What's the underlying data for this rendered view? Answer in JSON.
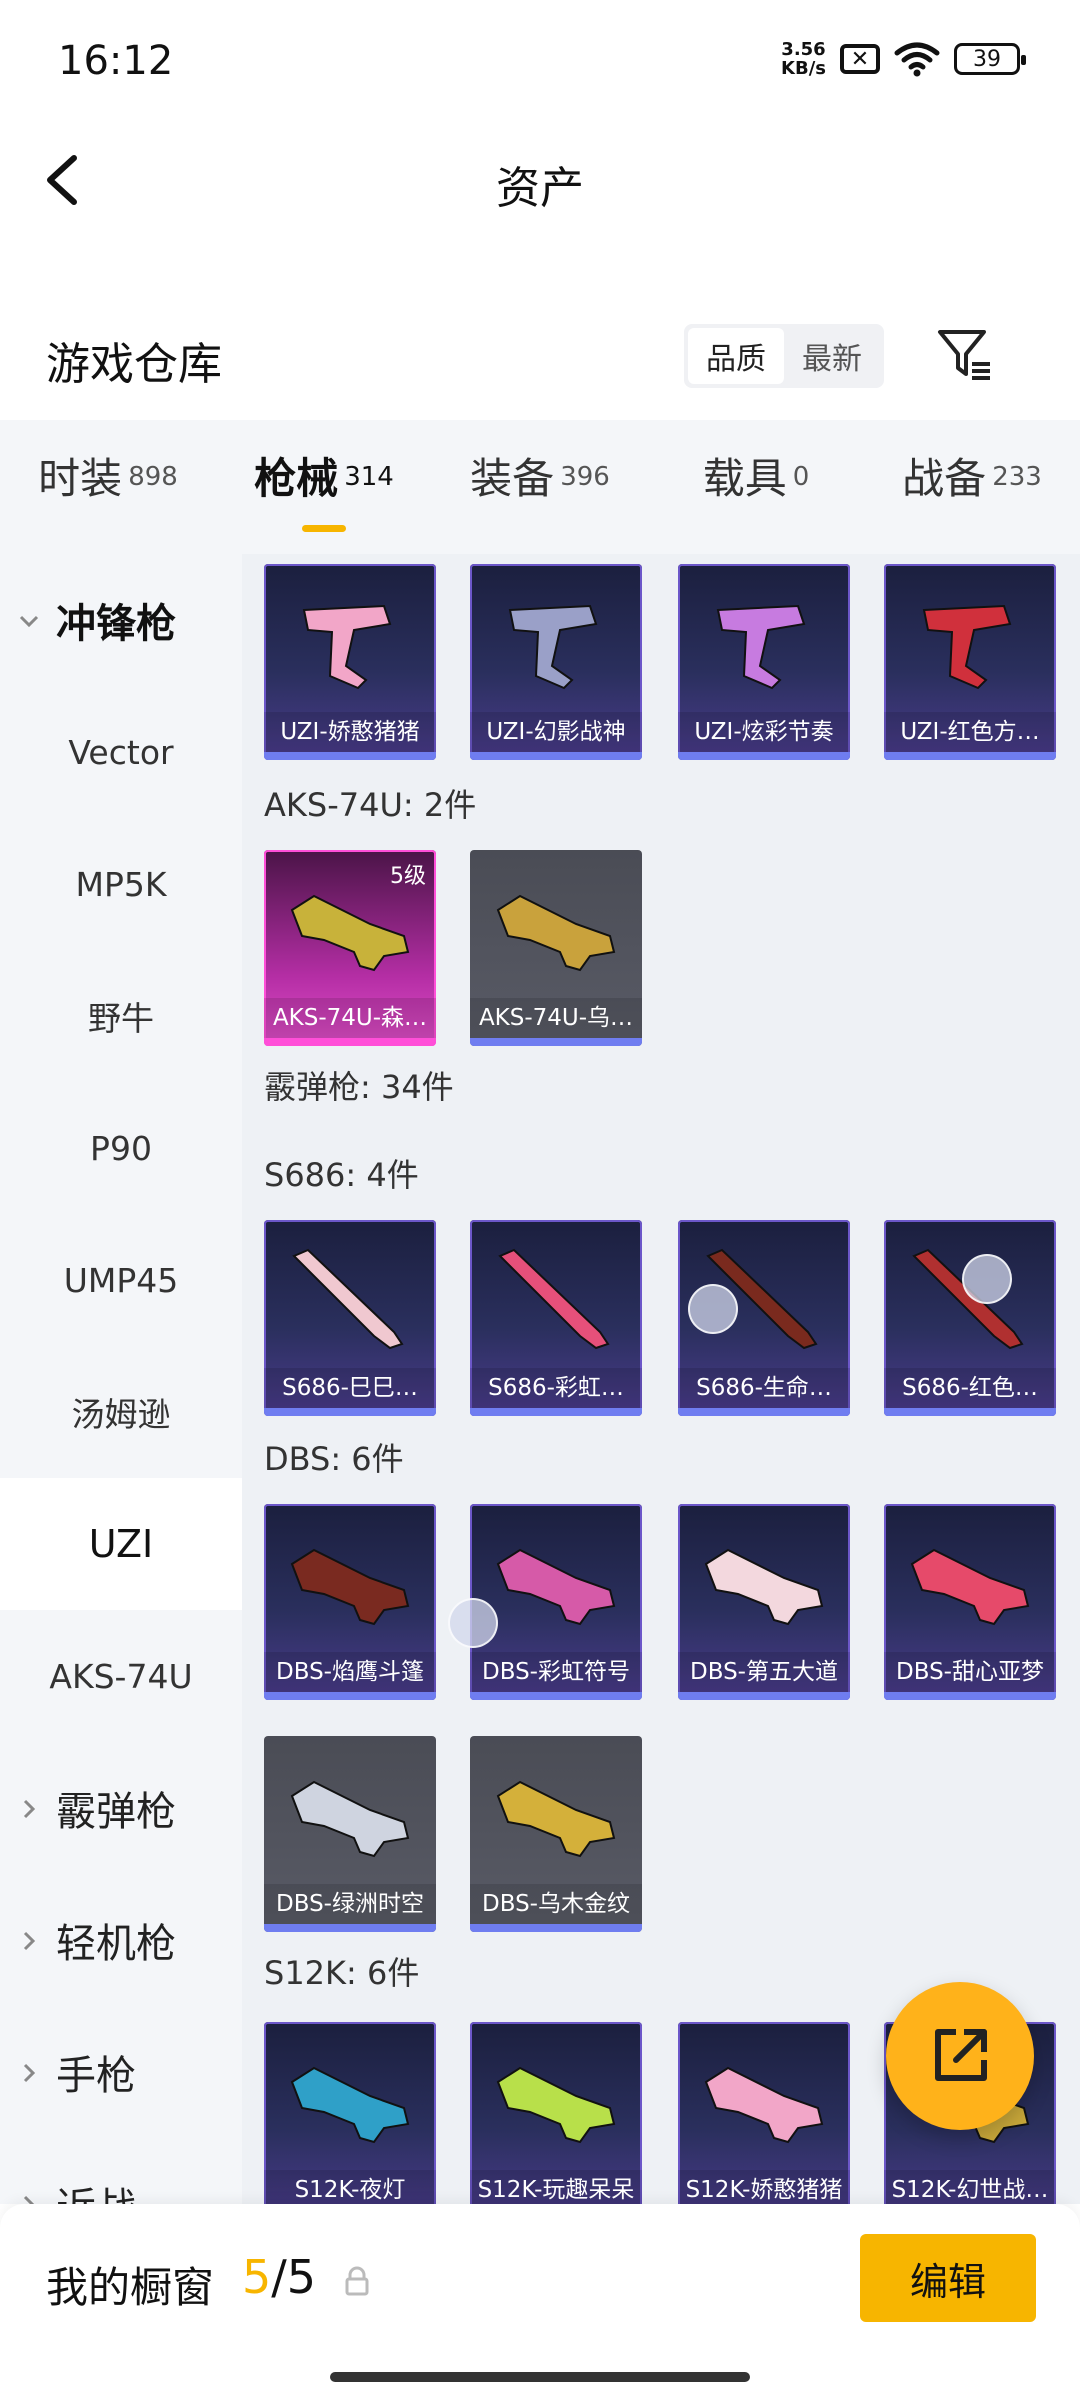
{
  "status_bar": {
    "time": "16:12",
    "net_speed_value": "3.56",
    "net_speed_unit": "KB/s",
    "battery": "39"
  },
  "header": {
    "title": "资产",
    "back_icon": "chevron-left-icon"
  },
  "warehouse": {
    "title": "游戏仓库",
    "sort_options": [
      "品质",
      "最新"
    ],
    "sort_selected": "品质",
    "filter_icon": "filter-icon"
  },
  "category_tabs": [
    {
      "label": "时装",
      "count": "898"
    },
    {
      "label": "枪械",
      "count": "314"
    },
    {
      "label": "装备",
      "count": "396"
    },
    {
      "label": "载具",
      "count": "0"
    },
    {
      "label": "战备",
      "count": "233"
    }
  ],
  "active_category": "枪械",
  "sidebar": [
    {
      "label": "冲锋枪",
      "type": "group",
      "expanded": true
    },
    {
      "label": "Vector",
      "type": "sub"
    },
    {
      "label": "MP5K",
      "type": "sub"
    },
    {
      "label": "野牛",
      "type": "sub"
    },
    {
      "label": "P90",
      "type": "sub"
    },
    {
      "label": "UMP45",
      "type": "sub"
    },
    {
      "label": "汤姆逊",
      "type": "sub"
    },
    {
      "label": "UZI",
      "type": "sub",
      "active": true
    },
    {
      "label": "AKS-74U",
      "type": "sub"
    },
    {
      "label": "霰弹枪",
      "type": "group",
      "expanded": false
    },
    {
      "label": "轻机枪",
      "type": "group",
      "expanded": false
    },
    {
      "label": "手枪",
      "type": "group",
      "expanded": false
    },
    {
      "label": "近战",
      "type": "group",
      "expanded": false
    }
  ],
  "content": {
    "uzi_cards": [
      {
        "name": "UZI-娇憨猪猪",
        "style": "purple",
        "accent": "#f2a6c8"
      },
      {
        "name": "UZI-幻影战神",
        "style": "purple",
        "accent": "#9aa0c8"
      },
      {
        "name": "UZI-炫彩节奏",
        "style": "purple",
        "accent": "#c77be0"
      },
      {
        "name": "UZI-红色方…",
        "style": "purple",
        "accent": "#d0303c"
      }
    ],
    "aks_section": "AKS-74U: 2件",
    "aks_cards": [
      {
        "name": "AKS-74U-森…",
        "style": "pink",
        "level": "5级",
        "accent": "#c8b23a"
      },
      {
        "name": "AKS-74U-乌…",
        "style": "gray",
        "accent": "#c9a23c"
      }
    ],
    "shotgun_section": "霰弹枪: 34件",
    "s686_section": "S686: 4件",
    "s686_cards": [
      {
        "name": "S686-巳巳…",
        "style": "purple",
        "accent": "#f0c8d0"
      },
      {
        "name": "S686-彩虹…",
        "style": "purple",
        "accent": "#e6507a"
      },
      {
        "name": "S686-生命…",
        "style": "purple",
        "accent": "#7a2a1e"
      },
      {
        "name": "S686-红色…",
        "style": "purple",
        "accent": "#b03030"
      }
    ],
    "dbs_section": "DBS: 6件",
    "dbs_cards": [
      {
        "name": "DBS-焰鹰斗篷",
        "style": "purple",
        "accent": "#7a2a20"
      },
      {
        "name": "DBS-彩虹符号",
        "style": "purple",
        "accent": "#d65aa8"
      },
      {
        "name": "DBS-第五大道",
        "style": "purple",
        "accent": "#f3d8de"
      },
      {
        "name": "DBS-甜心亚梦",
        "style": "purple",
        "accent": "#e64a6a"
      },
      {
        "name": "DBS-绿洲时空",
        "style": "gray",
        "accent": "#cfd4e0"
      },
      {
        "name": "DBS-乌木金纹",
        "style": "gray",
        "accent": "#d4b03a"
      }
    ],
    "s12k_section": "S12K: 6件",
    "s12k_cards": [
      {
        "name": "S12K-夜灯",
        "style": "purple",
        "accent": "#2fa0c8"
      },
      {
        "name": "S12K-玩趣呆呆",
        "style": "purple",
        "accent": "#b8e04a"
      },
      {
        "name": "S12K-娇憨猪猪",
        "style": "purple",
        "accent": "#f2a6c8"
      },
      {
        "name": "S12K-幻世战…",
        "style": "purple",
        "accent": "#c9a83a"
      }
    ]
  },
  "fab_icon": "share-external-icon",
  "bottom_bar": {
    "label": "我的橱窗",
    "current": "5",
    "separator": "/",
    "total": "5",
    "lock_icon": "lock-icon",
    "edit_label": "编辑"
  }
}
